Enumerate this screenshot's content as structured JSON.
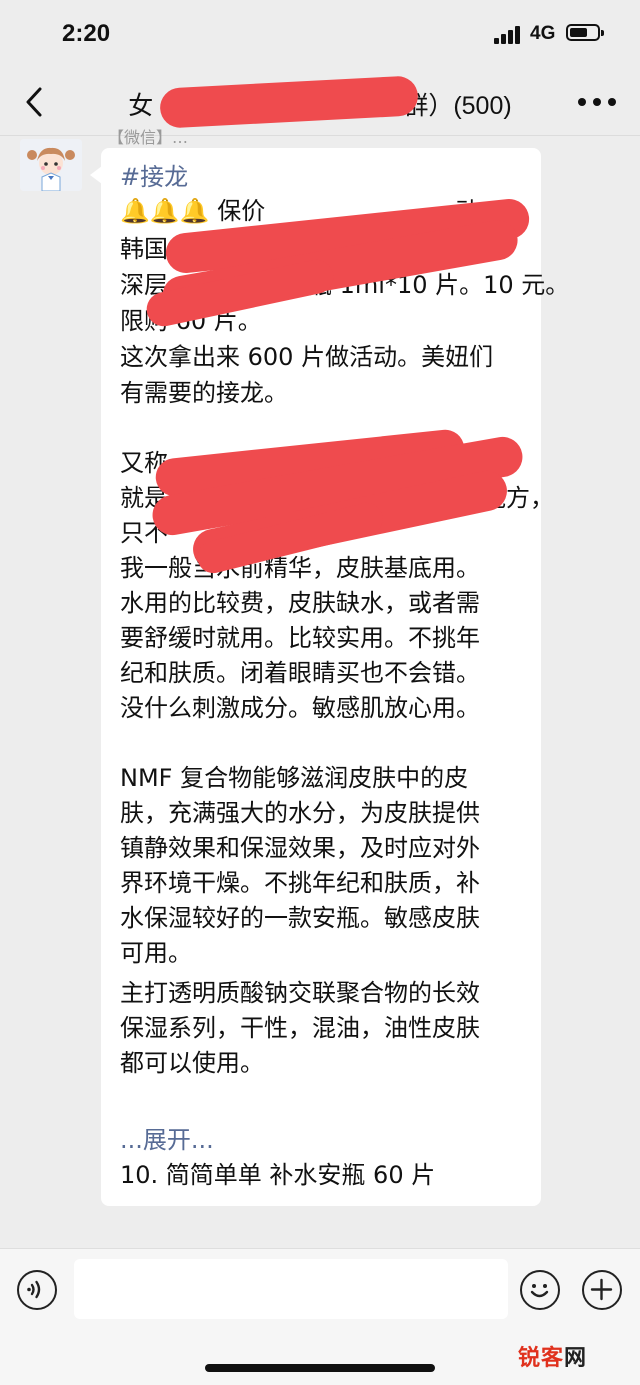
{
  "status_bar": {
    "time": "2:20",
    "network": "4G"
  },
  "nav": {
    "title": "女…………………………群）(500)",
    "title_visible_prefix": "女",
    "title_visible_suffix": "群）(500)"
  },
  "cut_line_text": "【微信】…",
  "message": {
    "hashtag": "#接龙",
    "bells": "🔔🔔🔔",
    "line_bells_text": " 保价",
    "line_bells_end": "动：",
    "line2": "韩国",
    "line3_start": "深层",
    "line3_end": "瓶 1ml*10 片。10 元。",
    "line4": "限购 60 片。",
    "line5": "这次拿出来 600 片做活动。美妞们",
    "line6": "有需要的接龙。",
    "line8_start": "又称",
    "line9_start": "就是",
    "line9_end": "的能方，",
    "line10": "只不",
    "line11": "我一般当水前精华，皮肤基底用。",
    "line12": "水用的比较费，皮肤缺水，或者需",
    "line13": "要舒缓时就用。比较实用。不挑年",
    "line14": "纪和肤质。闭着眼睛买也不会错。",
    "line15": "没什么刺激成分。敏感肌放心用。",
    "line17": "NMF 复合物能够滋润皮肤中的皮",
    "line18": "肤，充满强大的水分，为皮肤提供",
    "line19": "镇静效果和保湿效果，及时应对外",
    "line20": "界环境干燥。不挑年纪和肤质，补",
    "line21": "水保湿较好的一款安瓶。敏感皮肤",
    "line22": "可用。",
    "line23": "主打透明质酸钠交联聚合物的长效",
    "line24": "保湿系列，干性，混油，油性皮肤",
    "line25": "都可以使用。",
    "expand_label": "...展开...",
    "last_line": "10. 简简单单 补水安瓶 60 片"
  },
  "input": {
    "placeholder": ""
  },
  "watermark": {
    "part1": "锐客",
    "part2": "网"
  },
  "colors": {
    "background": "#ededed",
    "link": "#576b95",
    "redaction": "#ef4b4e",
    "bubble": "#ffffff"
  },
  "icons": [
    "back-icon",
    "more-icon",
    "voice-icon",
    "emoji-icon",
    "plus-icon",
    "avatar"
  ]
}
